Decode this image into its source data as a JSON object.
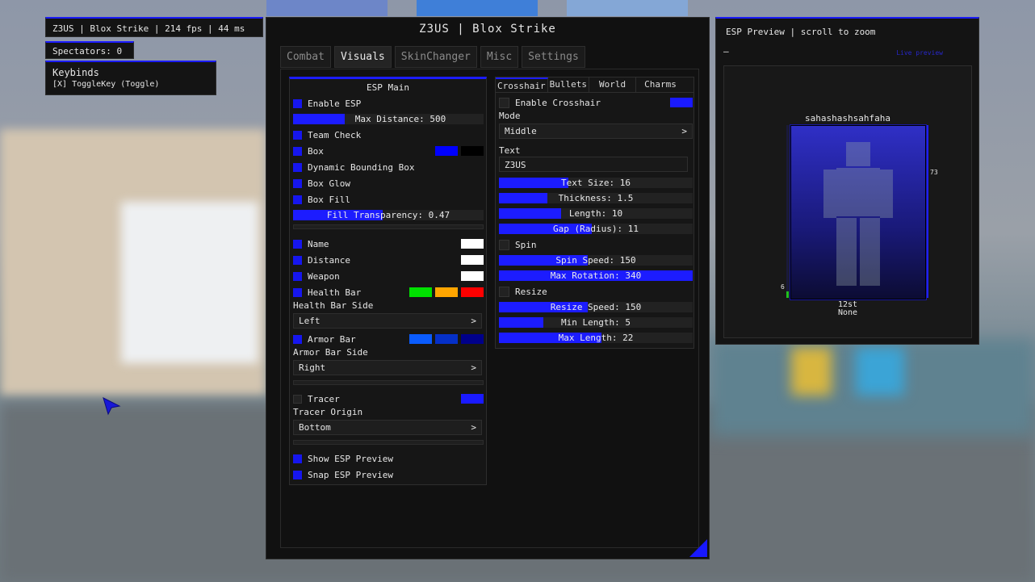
{
  "hud": {
    "watermark": "Z3US | Blox Strike | 214 fps | 44 ms",
    "spectators": "Spectators: 0",
    "keybinds_title": "Keybinds",
    "keybinds_line": "[X] ToggleKey (Toggle)"
  },
  "window": {
    "title": "Z3US | Blox Strike",
    "tabs": [
      "Combat",
      "Visuals",
      "SkinChanger",
      "Misc",
      "Settings"
    ],
    "active_tab": "Visuals"
  },
  "esp_main": {
    "header": "ESP Main",
    "enable_esp": "Enable ESP",
    "max_distance": "Max Distance: 500",
    "max_distance_fraction": 0.27,
    "team_check": "Team Check",
    "box": "Box",
    "dynamic_box": "Dynamic Bounding Box",
    "box_glow": "Box Glow",
    "box_fill": "Box Fill",
    "fill_transparency": "Fill Transparency: 0.47",
    "fill_transparency_fraction": 0.47,
    "name": "Name",
    "distance": "Distance",
    "weapon": "Weapon",
    "health_bar": "Health Bar",
    "health_bar_side_label": "Health Bar Side",
    "health_bar_side_value": "Left",
    "armor_bar": "Armor Bar",
    "armor_bar_side_label": "Armor Bar Side",
    "armor_bar_side_value": "Right",
    "tracer": "Tracer",
    "tracer_origin_label": "Tracer Origin",
    "tracer_origin_value": "Bottom",
    "show_preview": "Show ESP Preview",
    "snap_preview": "Snap ESP Preview",
    "arrow": ">"
  },
  "crosshair": {
    "tabs": [
      "Crosshair",
      "Bullets",
      "World",
      "Charms"
    ],
    "enable": "Enable Crosshair",
    "mode_label": "Mode",
    "mode_value": "Middle",
    "text_label": "Text",
    "text_value": "Z3US",
    "text_size": "Text Size: 16",
    "text_size_fraction": 0.36,
    "thickness": "Thickness: 1.5",
    "thickness_fraction": 0.25,
    "length": "Length: 10",
    "length_fraction": 0.32,
    "gap": "Gap (Radius): 11",
    "gap_fraction": 0.48,
    "spin": "Spin",
    "spin_speed": "Spin Speed: 150",
    "spin_speed_fraction": 0.46,
    "max_rotation": "Max Rotation: 340",
    "max_rotation_fraction": 1.0,
    "resize": "Resize",
    "resize_speed": "Resize Speed: 150",
    "resize_speed_fraction": 0.46,
    "min_length": "Min Length: 5",
    "min_length_fraction": 0.23,
    "max_length": "Max Length: 22",
    "max_length_fraction": 0.53,
    "arrow": ">"
  },
  "preview": {
    "title": "ESP Preview | scroll to zoom",
    "dash": "–",
    "link": "Live preview",
    "player_name": "sahashashsahfaha",
    "health_value": "6",
    "armor_value": "73",
    "distance": "12st",
    "weapon": "None"
  },
  "colors": {
    "accent": "#1c1cff",
    "box_color": "#0000ff",
    "box_outline": "#000000",
    "name_color": "#ffffff",
    "distance_color": "#ffffff",
    "weapon_color": "#ffffff",
    "health_high": "#00e000",
    "health_mid": "#ffa500",
    "health_low": "#ff0000",
    "armor_1": "#0a5cff",
    "armor_2": "#0530c8",
    "armor_3": "#00008a",
    "tracer_color": "#1a1aff",
    "crosshair_color": "#1a1aff"
  }
}
